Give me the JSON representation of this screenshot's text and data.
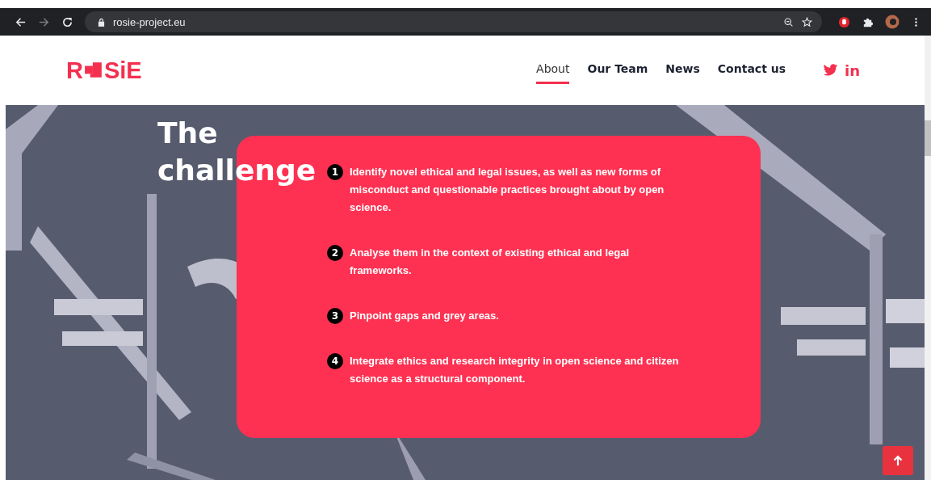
{
  "browser": {
    "url": "rosie-project.eu",
    "forward_disabled": true
  },
  "header": {
    "logo": {
      "before": "R",
      "after": "SiE"
    },
    "nav": [
      {
        "label": "About",
        "selected": true
      },
      {
        "label": "Our Team",
        "selected": false
      },
      {
        "label": "News",
        "selected": false
      },
      {
        "label": "Contact us",
        "selected": false
      }
    ],
    "social": {
      "linkedin": "in"
    }
  },
  "hero": {
    "title": "The challenge",
    "items": [
      {
        "number": "1",
        "text": "Identify novel ethical and legal issues, as well as new forms of misconduct and questionable practices brought about by open science."
      },
      {
        "number": "2",
        "text": "Analyse them in the context of existing ethical and legal frameworks."
      },
      {
        "number": "3",
        "text": "Pinpoint gaps and grey areas."
      },
      {
        "number": "4",
        "text": "Integrate ethics and research integrity in open science and citizen science as a structural component."
      }
    ]
  }
}
